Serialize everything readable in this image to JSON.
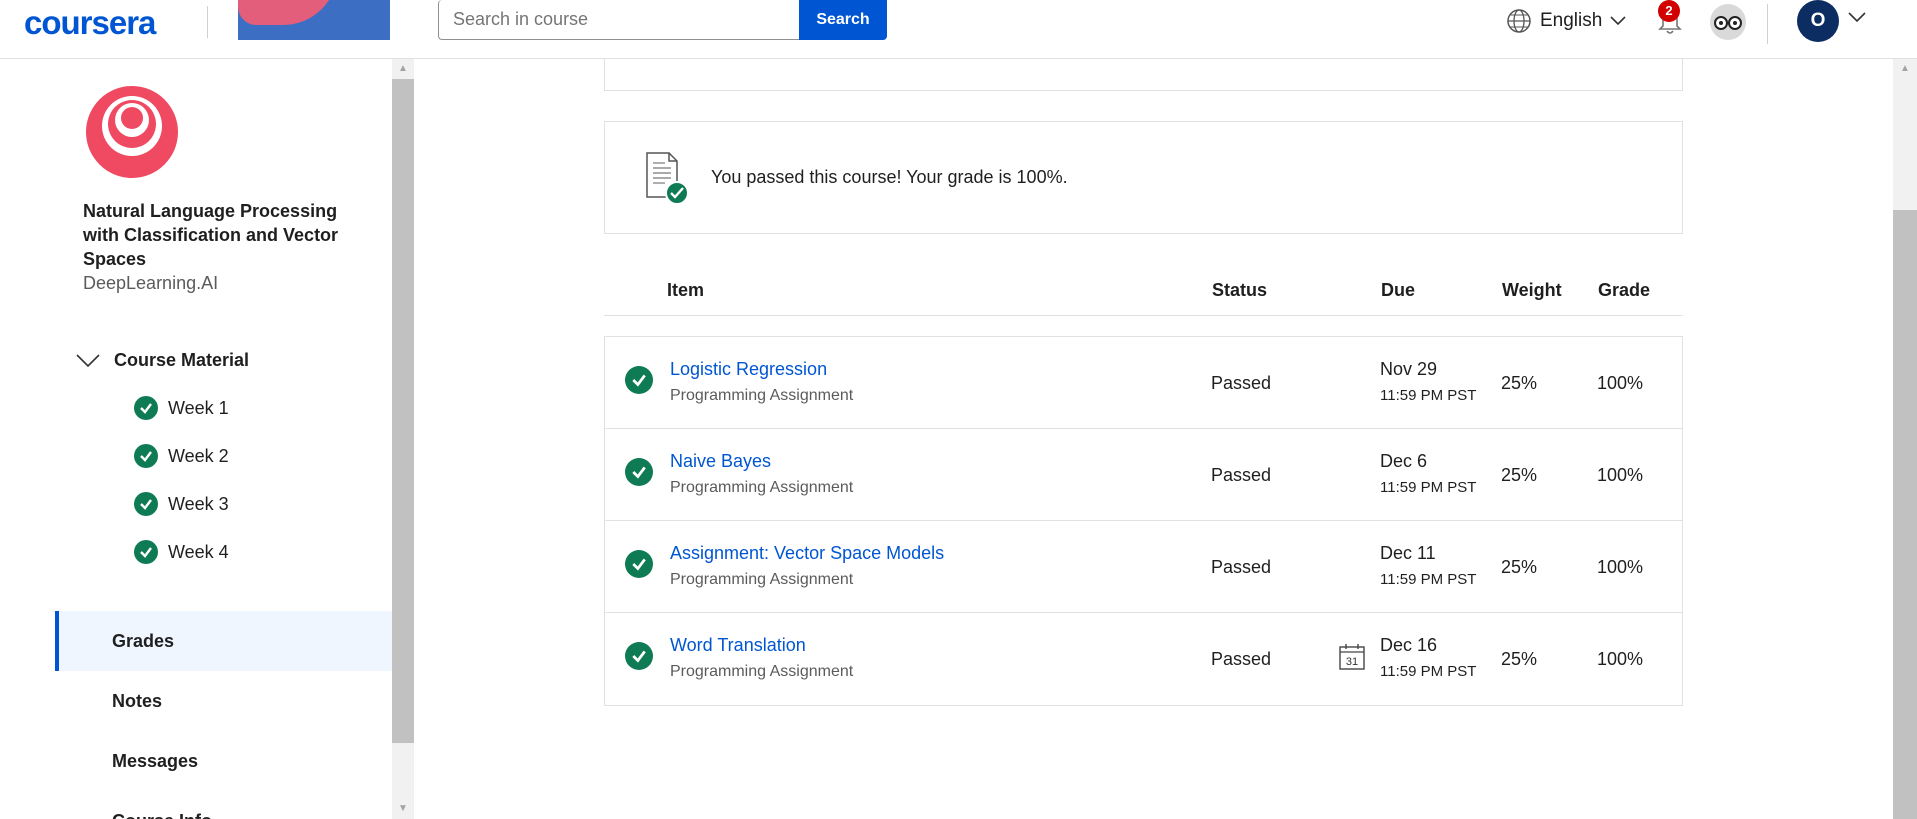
{
  "header": {
    "brand": "coursera",
    "search_placeholder": "Search in course",
    "search_button": "Search",
    "language": "English",
    "notification_count": "2",
    "avatar_initial": "O"
  },
  "sidebar": {
    "course_title": "Natural Language Processing with Classification and Vector Spaces",
    "partner": "DeepLearning.AI",
    "material_label": "Course Material",
    "weeks": [
      "Week 1",
      "Week 2",
      "Week 3",
      "Week 4"
    ],
    "nav": [
      "Grades",
      "Notes",
      "Messages",
      "Course Info"
    ]
  },
  "main": {
    "pass_message": "You passed this course! Your grade is 100%.",
    "columns": [
      "Item",
      "Status",
      "Due",
      "Weight",
      "Grade"
    ],
    "rows": [
      {
        "name": "Logistic Regression",
        "type": "Programming Assignment",
        "status": "Passed",
        "due_date": "Nov 29",
        "due_time": "11:59 PM PST",
        "weight": "25%",
        "grade": "100%"
      },
      {
        "name": "Naive Bayes",
        "type": "Programming Assignment",
        "status": "Passed",
        "due_date": "Dec 6",
        "due_time": "11:59 PM PST",
        "weight": "25%",
        "grade": "100%"
      },
      {
        "name": "Assignment: Vector Space Models",
        "type": "Programming Assignment",
        "status": "Passed",
        "due_date": "Dec 11",
        "due_time": "11:59 PM PST",
        "weight": "25%",
        "grade": "100%"
      },
      {
        "name": "Word Translation",
        "type": "Programming Assignment",
        "status": "Passed",
        "due_date": "Dec 16",
        "due_time": "11:59 PM PST",
        "weight": "25%",
        "grade": "100%",
        "calendar_day": "31"
      }
    ]
  },
  "colors": {
    "brand_blue": "#0056d2",
    "success_green": "#0f7b55",
    "badge_red": "#d30001"
  }
}
